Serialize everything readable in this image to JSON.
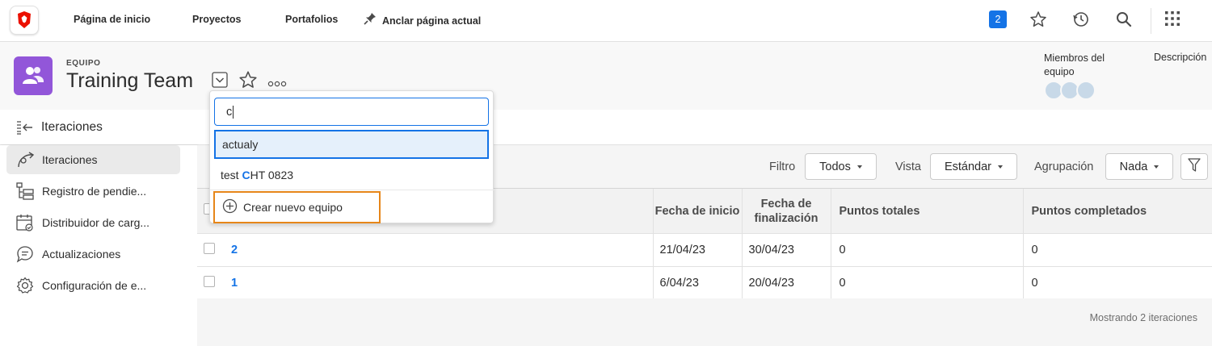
{
  "nav": {
    "home": "Página de inicio",
    "projects": "Proyectos",
    "portfolios": "Portafolios",
    "pin": "Anclar página actual",
    "notifications_count": "2"
  },
  "header": {
    "kicker": "EQUIPO",
    "title": "Training Team",
    "members_label": "Miembros del equipo",
    "description_label": "Descripción"
  },
  "sidebar": {
    "title": "Iteraciones",
    "items": [
      {
        "label": "Iteraciones"
      },
      {
        "label": "Registro de pendie..."
      },
      {
        "label": "Distribuidor de carg..."
      },
      {
        "label": "Actualizaciones"
      },
      {
        "label": "Configuración de e..."
      }
    ]
  },
  "toolbar": {
    "filter_label": "Filtro",
    "filter_value": "Todos",
    "view_label": "Vista",
    "view_value": "Estándar",
    "group_label": "Agrupación",
    "group_value": "Nada"
  },
  "table": {
    "headers": [
      "Fecha de inicio",
      "Fecha de finalización",
      "Puntos totales",
      "Puntos completados"
    ],
    "rows": [
      {
        "name": "2",
        "start": "21/04/23",
        "end": "30/04/23",
        "total": "0",
        "completed": "0"
      },
      {
        "name": "1",
        "start": "6/04/23",
        "end": "20/04/23",
        "total": "0",
        "completed": "0"
      }
    ],
    "footer": "Mostrando 2 iteraciones"
  },
  "dropdown": {
    "search_value": "c",
    "options": [
      {
        "label": "actualy"
      },
      {
        "prefix": "test ",
        "match": "C",
        "suffix": "HT 0823"
      }
    ],
    "create_label": "Crear nuevo equipo"
  },
  "colors": {
    "accent": "#1473e6",
    "team_avatar": "#9256d9",
    "highlight_border": "#e68619"
  }
}
